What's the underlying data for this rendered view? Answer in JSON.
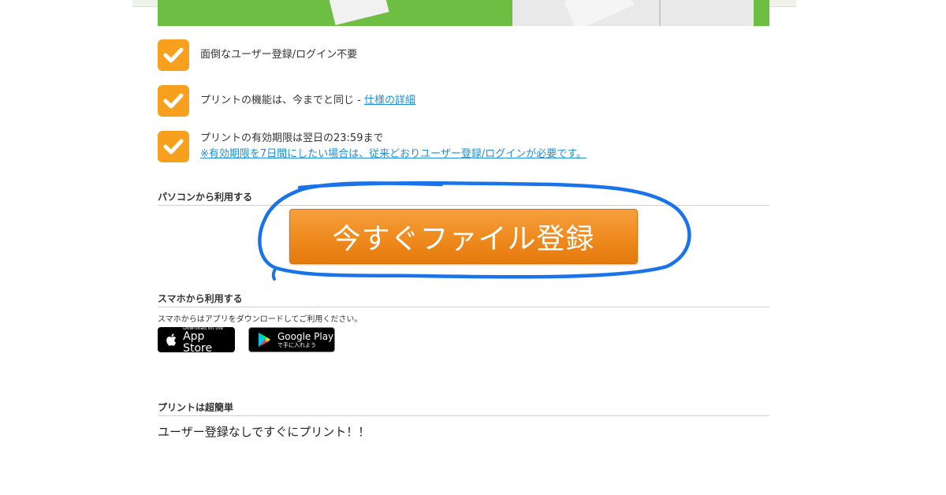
{
  "features": [
    {
      "text": "面倒なユーザー登録/ログイン不要"
    },
    {
      "text": "プリントの機能は、今までと同じ - ",
      "link": "仕様の詳細"
    },
    {
      "text": "プリントの有効期限は翌日の23:59まで",
      "link": "※有効期限を7日間にしたい場合は、従来どおりユーザー登録/ログインが必要です。"
    }
  ],
  "pc_section": {
    "title": "パソコンから利用する",
    "cta_label": "今すぐファイル登録"
  },
  "sp_section": {
    "title": "スマホから利用する",
    "note": "スマホからはアプリをダウンロードしてご利用ください。",
    "app_store": {
      "small": "Download on the",
      "big": "App Store"
    },
    "google_play": {
      "big": "Google Play",
      "small": "で手に入れよう"
    }
  },
  "easy_section": {
    "title": "プリントは超簡単",
    "body": "ユーザー登録なしですぐにプリント！！"
  },
  "colors": {
    "accent_orange": "#f7a01e",
    "cta_orange": "#ee8a1e",
    "link_blue": "#1e8fd4",
    "annotation_blue": "#1a73e8",
    "banner_green": "#6fbe44"
  },
  "icons": [
    "check-icon",
    "apple-icon",
    "google-play-icon"
  ]
}
